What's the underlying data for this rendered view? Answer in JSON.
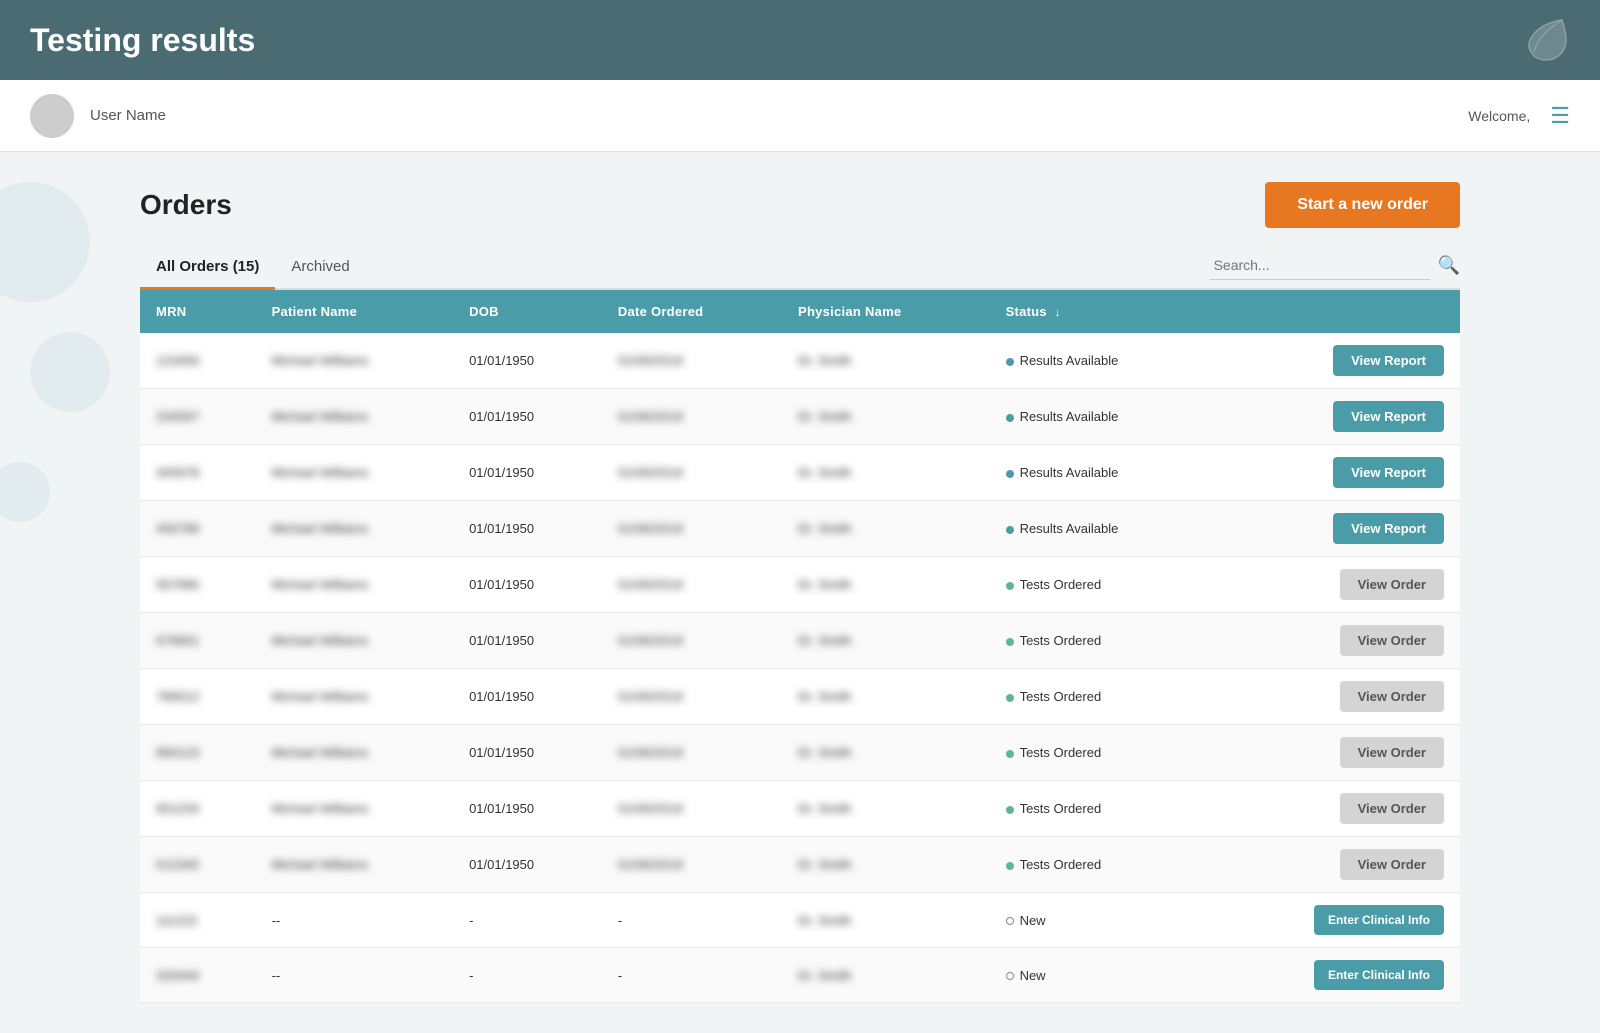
{
  "header": {
    "title": "Testing results",
    "logo_alt": "leaf-logo"
  },
  "subheader": {
    "avatar_initials": "👤",
    "user_name": "User Name",
    "welcome_text": "Welcome,",
    "hamburger_label": "≡"
  },
  "orders": {
    "title": "Orders",
    "start_order_btn": "Start a new order",
    "tabs": [
      {
        "label": "All Orders (15)",
        "active": true
      },
      {
        "label": "Archived",
        "active": false
      }
    ],
    "search_placeholder": "Search...",
    "table": {
      "columns": [
        "MRN",
        "Patient Name",
        "DOB",
        "Date Ordered",
        "Physician Name",
        "Status"
      ],
      "rows": [
        {
          "mrn": "123456",
          "patient": "Michael Williams",
          "dob": "01/01/1950",
          "date_ordered": "01/06/2019",
          "physician": "Dr. Smith",
          "status": "Results Available",
          "status_type": "results",
          "action": "View Report"
        },
        {
          "mrn": "234567",
          "patient": "Michael Williams",
          "dob": "01/01/1950",
          "date_ordered": "01/06/2019",
          "physician": "Dr. Smith",
          "status": "Results Available",
          "status_type": "results",
          "action": "View Report"
        },
        {
          "mrn": "345678",
          "patient": "Michael Williams",
          "dob": "01/01/1950",
          "date_ordered": "01/06/2019",
          "physician": "Dr. Smith",
          "status": "Results Available",
          "status_type": "results",
          "action": "View Report"
        },
        {
          "mrn": "456789",
          "patient": "Michael Williams",
          "dob": "01/01/1950",
          "date_ordered": "01/06/2019",
          "physician": "Dr. Smith",
          "status": "Results Available",
          "status_type": "results",
          "action": "View Report"
        },
        {
          "mrn": "567890",
          "patient": "Michael Williams",
          "dob": "01/01/1950",
          "date_ordered": "01/06/2019",
          "physician": "Dr. Smith",
          "status": "Tests Ordered",
          "status_type": "ordered",
          "action": "View Order"
        },
        {
          "mrn": "678901",
          "patient": "Michael Williams",
          "dob": "01/01/1950",
          "date_ordered": "01/06/2019",
          "physician": "Dr. Smith",
          "status": "Tests Ordered",
          "status_type": "ordered",
          "action": "View Order"
        },
        {
          "mrn": "789012",
          "patient": "Michael Williams",
          "dob": "01/01/1950",
          "date_ordered": "01/06/2019",
          "physician": "Dr. Smith",
          "status": "Tests Ordered",
          "status_type": "ordered",
          "action": "View Order"
        },
        {
          "mrn": "890123",
          "patient": "Michael Williams",
          "dob": "01/01/1950",
          "date_ordered": "01/06/2019",
          "physician": "Dr. Smith",
          "status": "Tests Ordered",
          "status_type": "ordered",
          "action": "View Order"
        },
        {
          "mrn": "901234",
          "patient": "Michael Williams",
          "dob": "01/01/1950",
          "date_ordered": "01/06/2019",
          "physician": "Dr. Smith",
          "status": "Tests Ordered",
          "status_type": "ordered",
          "action": "View Order"
        },
        {
          "mrn": "012345",
          "patient": "Michael Williams",
          "dob": "01/01/1950",
          "date_ordered": "01/06/2019",
          "physician": "Dr. Smith",
          "status": "Tests Ordered",
          "status_type": "ordered",
          "action": "View Order"
        },
        {
          "mrn": "111222",
          "patient": "--",
          "dob": "-",
          "date_ordered": "-",
          "physician": "Dr. Smith",
          "status": "New",
          "status_type": "new",
          "action": "Enter Clinical Info"
        },
        {
          "mrn": "333444",
          "patient": "--",
          "dob": "-",
          "date_ordered": "-",
          "physician": "Dr. Smith",
          "status": "New",
          "status_type": "new",
          "action": "Enter Clinical Info"
        }
      ]
    }
  },
  "colors": {
    "teal": "#4a9da8",
    "orange": "#e87722",
    "header_bg": "#4a6b72"
  }
}
